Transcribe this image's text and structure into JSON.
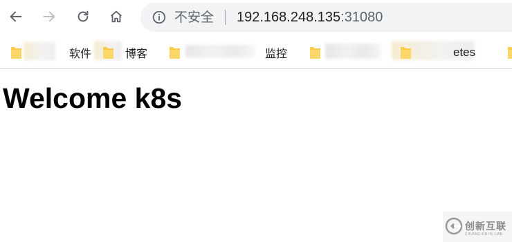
{
  "browser": {
    "security_label": "不安全",
    "url_host": "192.168.248.135",
    "url_port": ":31080",
    "icons": {
      "back": "arrow-left-icon",
      "forward": "arrow-right-icon",
      "reload": "reload-icon",
      "home": "home-icon",
      "info": "info-circle-icon"
    }
  },
  "bookmarks": [
    {
      "label": "软件"
    },
    {
      "label": "博客"
    },
    {
      "label": ""
    },
    {
      "label": "监控"
    },
    {
      "label": ""
    },
    {
      "label": "etes"
    }
  ],
  "page": {
    "heading": "Welcome k8s"
  },
  "watermark": {
    "text": "创新互联",
    "subtext": "CHUANG XIN HU LIAN"
  },
  "colors": {
    "toolbar_bg": "#ffffff",
    "omnibox_bg": "#f1f3f4",
    "folder_yellow": "#f9cc4c",
    "text_gray": "#5f6368"
  }
}
